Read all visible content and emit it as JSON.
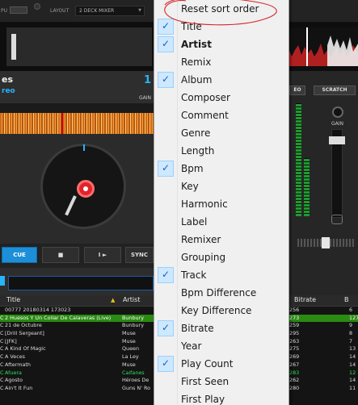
{
  "topbar": {
    "cpu_label": "PU",
    "layout_label": "LAYOUT",
    "layout_value": "2 DECK MIXER"
  },
  "deck": {
    "title_partial": "es",
    "subtitle_partial": "reo",
    "deck_number": "1",
    "gain_label": "GAIN"
  },
  "transport": {
    "cue": "CUE",
    "stop": "■",
    "play": "I ► ",
    "sync": "SYNC"
  },
  "mixer": {
    "fx_label": "EO",
    "scratch_label": "SCRATCH",
    "gain_label": "GAIN"
  },
  "context_menu": {
    "items": [
      {
        "label": "Reset sort order",
        "checked": false,
        "bold": false
      },
      {
        "label": "Title",
        "checked": true,
        "bold": false
      },
      {
        "label": "Artist",
        "checked": true,
        "bold": true
      },
      {
        "label": "Remix",
        "checked": false,
        "bold": false
      },
      {
        "label": "Album",
        "checked": true,
        "bold": false
      },
      {
        "label": "Composer",
        "checked": false,
        "bold": false
      },
      {
        "label": "Comment",
        "checked": false,
        "bold": false
      },
      {
        "label": "Genre",
        "checked": false,
        "bold": false
      },
      {
        "label": "Length",
        "checked": false,
        "bold": false
      },
      {
        "label": "Bpm",
        "checked": true,
        "bold": false
      },
      {
        "label": "Key",
        "checked": false,
        "bold": false
      },
      {
        "label": "Harmonic",
        "checked": false,
        "bold": false
      },
      {
        "label": "Label",
        "checked": false,
        "bold": false
      },
      {
        "label": "Remixer",
        "checked": false,
        "bold": false
      },
      {
        "label": "Grouping",
        "checked": false,
        "bold": false
      },
      {
        "label": "Track",
        "checked": true,
        "bold": false
      },
      {
        "label": "Bpm Difference",
        "checked": false,
        "bold": false
      },
      {
        "label": "Key Difference",
        "checked": false,
        "bold": false
      },
      {
        "label": "Bitrate",
        "checked": true,
        "bold": false
      },
      {
        "label": "Year",
        "checked": false,
        "bold": false
      },
      {
        "label": "Play Count",
        "checked": true,
        "bold": false
      },
      {
        "label": "First Seen",
        "checked": false,
        "bold": false
      },
      {
        "label": "First Play",
        "checked": false,
        "bold": false
      }
    ],
    "check_glyph": "✓"
  },
  "browser": {
    "headers": {
      "title": "Title",
      "artist": "Artist",
      "bitrate": "Bitrate",
      "extra": "B"
    },
    "rows": [
      {
        "prefix": "",
        "title": "00777 20180314 173023",
        "artist": "",
        "bitrate": "256",
        "extra": "6",
        "state": "normal"
      },
      {
        "prefix": "C",
        "title": "2 Huesos Y Un Collar De Calaveras (Live)",
        "artist": "Bunbury",
        "bitrate": "273",
        "extra": "127.0",
        "state": "selected"
      },
      {
        "prefix": "C",
        "title": "21 de Octubre",
        "artist": "Bunbury",
        "bitrate": "259",
        "extra": "9",
        "state": "normal"
      },
      {
        "prefix": "C",
        "title": "[Drill Sergeant]",
        "artist": "Muse",
        "bitrate": "295",
        "extra": "8",
        "state": "normal"
      },
      {
        "prefix": "C",
        "title": "[JFK]",
        "artist": "Muse",
        "bitrate": "263",
        "extra": "7",
        "state": "normal"
      },
      {
        "prefix": "C",
        "title": "A Kind Of Magic",
        "artist": "Queen",
        "bitrate": "275",
        "extra": "13",
        "state": "normal"
      },
      {
        "prefix": "C",
        "title": "A Veces",
        "artist": "La Ley",
        "bitrate": "269",
        "extra": "14",
        "state": "normal"
      },
      {
        "prefix": "C",
        "title": "Aftermath",
        "artist": "Muse",
        "bitrate": "267",
        "extra": "14",
        "state": "normal"
      },
      {
        "prefix": "C",
        "title": "Afuera",
        "artist": "Caifanes",
        "bitrate": "283",
        "extra": "12",
        "state": "green"
      },
      {
        "prefix": "C",
        "title": "Agosto",
        "artist": "Héroes De",
        "bitrate": "262",
        "extra": "14",
        "state": "normal"
      },
      {
        "prefix": "C",
        "title": "Ain't It Fun",
        "artist": "Guns N' Ro",
        "bitrate": "280",
        "extra": "11",
        "state": "normal"
      }
    ]
  },
  "colors": {
    "accent_blue": "#26b4ff",
    "selected_row": "#2a8a12",
    "annotation_red": "#d3262a"
  }
}
